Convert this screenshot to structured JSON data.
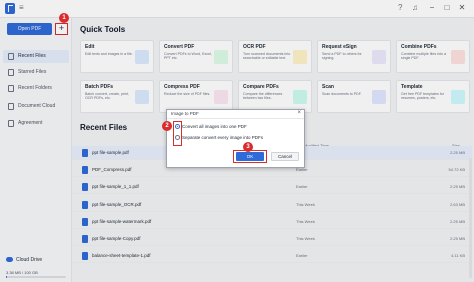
{
  "window": {
    "controls": [
      "−",
      "□",
      "✕"
    ]
  },
  "sidebar": {
    "open_pdf_label": "Open PDF",
    "plus_label": "+",
    "items": [
      {
        "label": "Recent Files",
        "active": true
      },
      {
        "label": "Starred Files",
        "active": false
      },
      {
        "label": "Recent Folders",
        "active": false
      },
      {
        "label": "Document Cloud",
        "active": false
      },
      {
        "label": "Agreement",
        "active": false
      }
    ],
    "cloud_drive_label": "Cloud Drive",
    "storage_text": "3.38 MB / 100 GB",
    "storage_fraction": 0.0
  },
  "quick_tools": {
    "title": "Quick Tools",
    "tools": [
      {
        "name": "Edit",
        "desc": "Edit texts and images in a file.",
        "color": "#3b82f6"
      },
      {
        "name": "Convert PDF",
        "desc": "Convert PDFs to Word, Excel, PPT etc.",
        "color": "#22c55e"
      },
      {
        "name": "OCR PDF",
        "desc": "Turn scanned documents into searchable or editable text.",
        "color": "#f59e0b"
      },
      {
        "name": "Request eSign",
        "desc": "Send a PDF to others for signing.",
        "color": "#8b5cf6"
      },
      {
        "name": "Combine PDFs",
        "desc": "Combine multiple files into a single PDF.",
        "color": "#ef4444"
      },
      {
        "name": "Batch PDFs",
        "desc": "Batch convert, create, print, OCR PDFs, etc.",
        "color": "#3b82f6"
      },
      {
        "name": "Compress PDF",
        "desc": "Reduce the size of PDF files.",
        "color": "#ec4899"
      },
      {
        "name": "Compare PDFs",
        "desc": "Compare the differences between two files.",
        "color": "#14b8a6"
      },
      {
        "name": "Scan",
        "desc": "Scan documents to PDF.",
        "color": "#6366f1"
      },
      {
        "name": "Template",
        "desc": "Get free PDF templates for resumes, posters, etc.",
        "color": "#06b6d4"
      }
    ]
  },
  "recent_files": {
    "title": "Recent Files",
    "columns": {
      "date": "Modified Time",
      "size": "Size"
    },
    "rows": [
      {
        "name": "ppt file-sample.pdf",
        "date": "",
        "size": "2.25 MB",
        "selected": true
      },
      {
        "name": "PDF_Compress.pdf",
        "date": "Earlier",
        "size": "54.72 KB",
        "selected": false
      },
      {
        "name": "ppt file-sample_1_1.pdf",
        "date": "Earlier",
        "size": "2.25 MB",
        "selected": false
      },
      {
        "name": "ppt file-sample_OCR.pdf",
        "date": "This Week",
        "size": "2.63 MB",
        "selected": false
      },
      {
        "name": "ppt file-sample-watermark.pdf",
        "date": "This Week",
        "size": "2.25 MB",
        "selected": false
      },
      {
        "name": "ppt file-sample-Copy.pdf",
        "date": "This Week",
        "size": "2.25 MB",
        "selected": false
      },
      {
        "name": "balance-sheet-template-1.pdf",
        "date": "Earlier",
        "size": "4.11 KB",
        "selected": false
      }
    ]
  },
  "dialog": {
    "title": "Image to PDF",
    "option_1": "Convert all images into one PDF",
    "option_2": "Separate convert every image into PDFs",
    "ok_label": "OK",
    "cancel_label": "Cancel"
  },
  "badges": [
    "1",
    "2",
    "3"
  ],
  "colors": {
    "accent": "#2f6bd8",
    "highlight": "#d92c2c"
  }
}
